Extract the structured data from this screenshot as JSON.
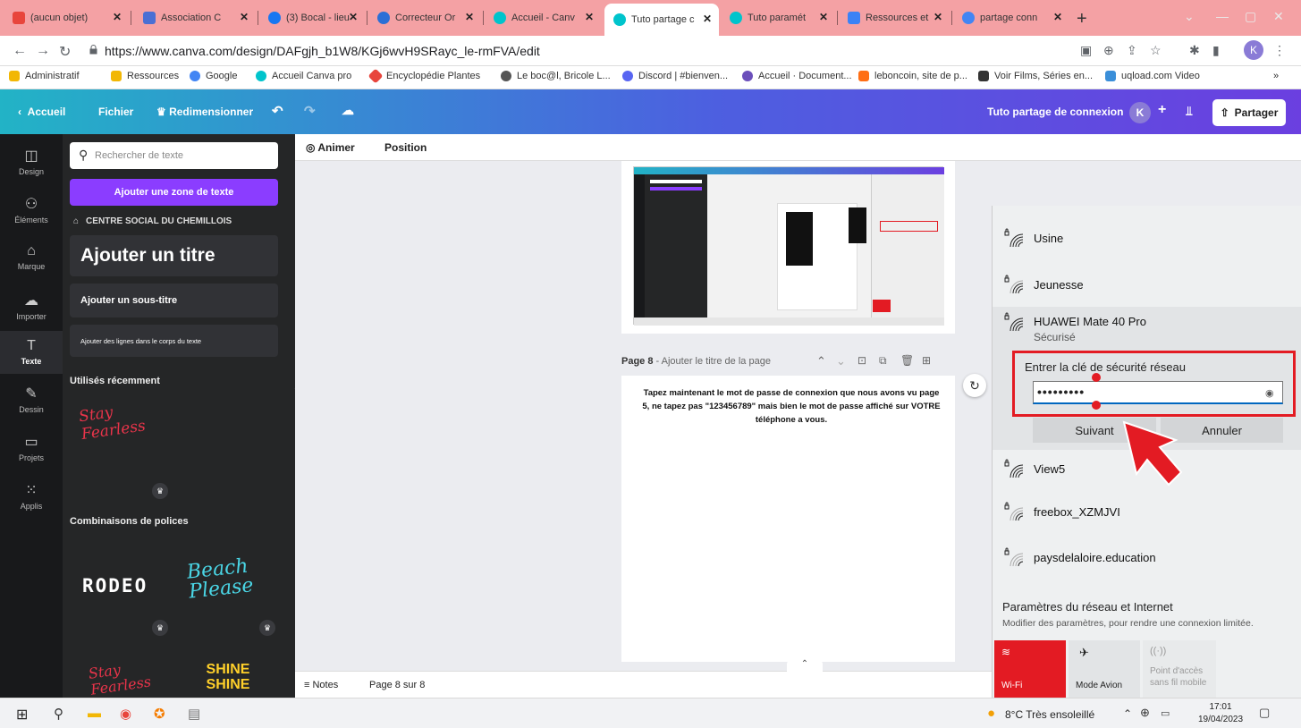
{
  "browser": {
    "tabs": [
      {
        "title": "(aucun objet)",
        "icon_color": "#e8453c"
      },
      {
        "title": "Association C",
        "icon_color": "#4a6fd4"
      },
      {
        "title": "(3) Bocal - lieu",
        "icon_color": "#1877f2"
      },
      {
        "title": "Correcteur Or",
        "icon_color": "#2b6fd6"
      },
      {
        "title": "Accueil - Canv",
        "icon_color": "#00c4cc"
      },
      {
        "title": "Tuto partage c",
        "icon_color": "#00c4cc"
      },
      {
        "title": "Tuto paramét",
        "icon_color": "#00c4cc"
      },
      {
        "title": "Ressources et",
        "icon_color": "#3b82f6"
      },
      {
        "title": "partage conn",
        "icon_color": "#4285f4"
      }
    ],
    "new_tab": "+",
    "url": "https://www.canva.com/design/DAFgjh_b1W8/KGj6wvH9SRayc_le-rmFVA/edit",
    "profile_initial": "K",
    "bookmarks": [
      {
        "label": "Administratif",
        "color": "#f2b705"
      },
      {
        "label": "Ressources",
        "color": "#f2b705"
      },
      {
        "label": "Google",
        "color": "#4285f4"
      },
      {
        "label": "Accueil Canva pro",
        "color": "#00c4cc"
      },
      {
        "label": "Encyclopédie Plantes",
        "color": "#e8453c"
      },
      {
        "label": "Le boc@l, Bricole L...",
        "color": "#555555"
      },
      {
        "label": "Discord | #bienven...",
        "color": "#5865f2"
      },
      {
        "label": "Accueil · Document...",
        "color": "#6b4fbb"
      },
      {
        "label": "leboncoin, site de p...",
        "color": "#ff6e14"
      },
      {
        "label": "Voir Films, Séries en...",
        "color": "#333333"
      },
      {
        "label": "uqload.com Video",
        "color": "#3b8fd9"
      }
    ],
    "more_bookmarks": "»"
  },
  "canva_bar": {
    "back": "Accueil",
    "file": "Fichier",
    "resize": "Redimensionner",
    "doc_title": "Tuto partage de connexion",
    "avatar": "K",
    "plus": "+",
    "share": "Partager"
  },
  "rail": [
    {
      "label": "Design",
      "icon": "layout-icon"
    },
    {
      "label": "Éléments",
      "icon": "elements-icon"
    },
    {
      "label": "Marque",
      "icon": "brand-icon"
    },
    {
      "label": "Importer",
      "icon": "upload-icon"
    },
    {
      "label": "Texte",
      "icon": "text-icon"
    },
    {
      "label": "Dessin",
      "icon": "draw-icon"
    },
    {
      "label": "Projets",
      "icon": "folder-icon"
    },
    {
      "label": "Applis",
      "icon": "apps-icon"
    }
  ],
  "text_panel": {
    "search_placeholder": "Rechercher de texte",
    "add_text_box": "Ajouter une zone de texte",
    "brand_kit": "CENTRE SOCIAL DU CHEMILLOIS",
    "add_title": "Ajouter un titre",
    "add_subtitle": "Ajouter un sous-titre",
    "add_body": "Ajouter des lignes dans le corps du texte",
    "recent": "Utilisés récemment",
    "combos": "Combinaisons de polices",
    "sample_stay": "Stay Fearless",
    "sample_rodeo": "RODEO",
    "sample_beach": "Beach Please",
    "sample_shine": "SHINE SHINE"
  },
  "canvas_toolbar": {
    "animate": "Animer",
    "position": "Position"
  },
  "page": {
    "header_label": "Page 8",
    "header_title": " - Ajouter le titre de la page",
    "body_text": "Tapez maintenant le mot de passe de connexion que nous avons vu page 5, ne tapez pas \"123456789\" mais bien le mot de passe affiché sur VOTRE téléphone a vous."
  },
  "bottom_bar": {
    "notes": "Notes",
    "page_counter": "Page 8 sur 8"
  },
  "wifi_panel": {
    "networks": [
      "Usine",
      "Jeunesse",
      "HUAWEI Mate 40 Pro",
      "View5",
      "freebox_XZMJVI",
      "paysdelaloire.education"
    ],
    "selected_status": "Sécurisé",
    "key_label": "Entrer la clé de sécurité réseau",
    "key_value": "•••••••••",
    "next": "Suivant",
    "cancel": "Annuler",
    "settings_title": "Paramètres du réseau et Internet",
    "settings_sub": "Modifier des paramètres, pour rendre une connexion limitée.",
    "tiles": [
      "Wi-Fi",
      "Mode Avion",
      "Point d'accès sans fil mobile"
    ],
    "highlight_color": "#e31b23"
  },
  "taskbar": {
    "weather": "8°C  Très ensoleillé",
    "time": "17:01",
    "date": "19/04/2023"
  }
}
